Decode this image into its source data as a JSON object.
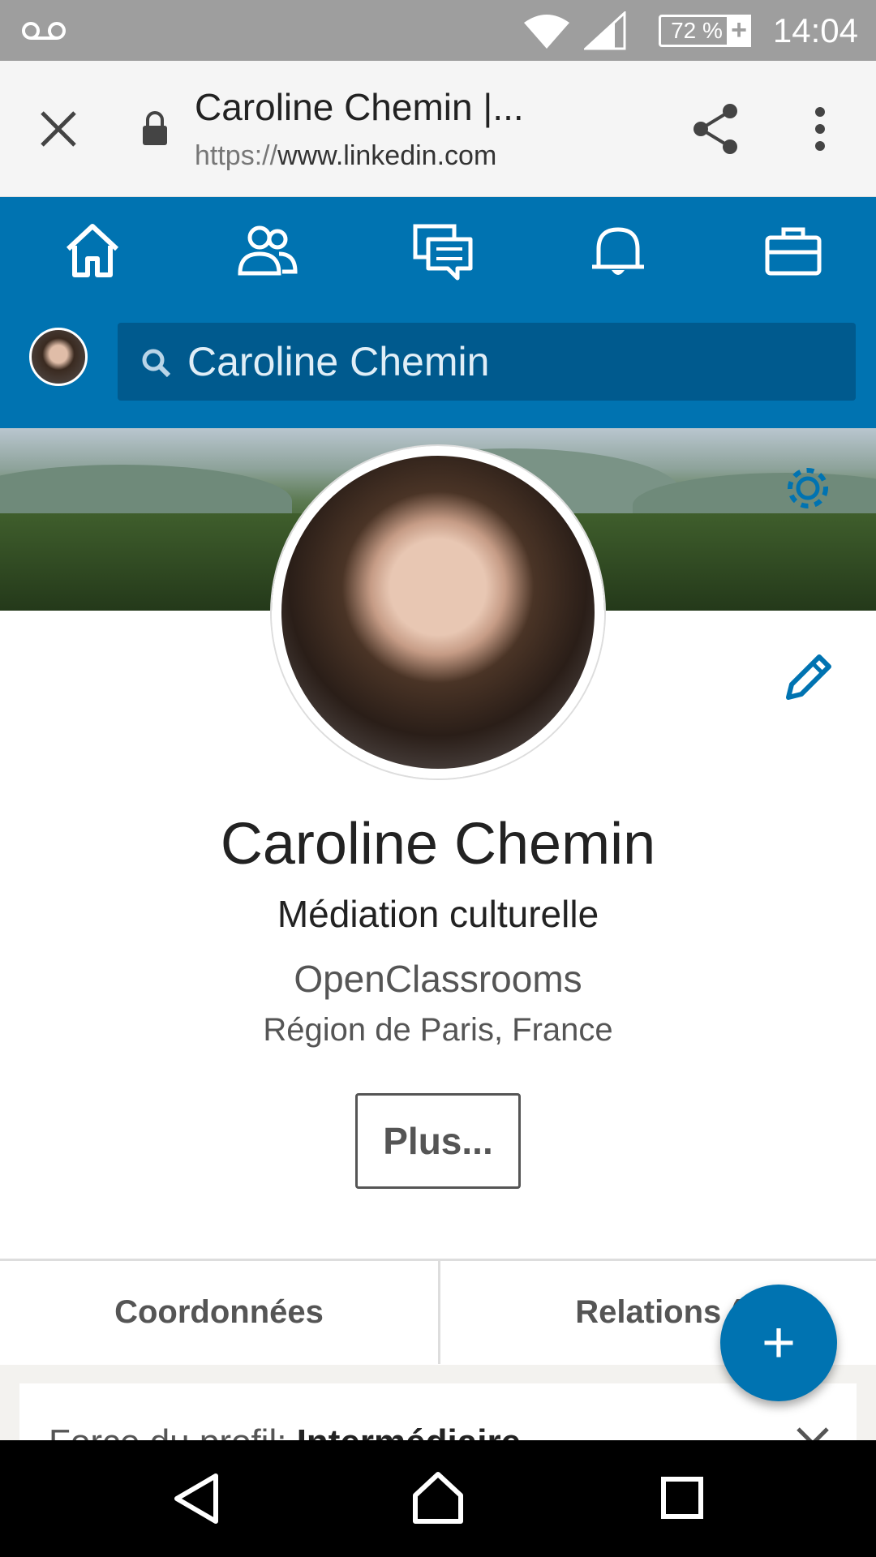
{
  "status_bar": {
    "battery": "72 %",
    "time": "14:04"
  },
  "browser": {
    "title": "Caroline Chemin |...",
    "url_scheme": "https://",
    "url_host": "www.linkedin.com"
  },
  "search": {
    "value": "Caroline Chemin"
  },
  "profile": {
    "name": "Caroline Chemin",
    "headline": "Médiation culturelle",
    "company": "OpenClassrooms",
    "location": "Région de Paris, France",
    "more_label": "Plus..."
  },
  "tabs": {
    "contact_label": "Coordonnées",
    "relations_label": "Relations ("
  },
  "strength": {
    "label": "Force du profil:",
    "value": "Intermédiaire"
  },
  "fab_label": "+",
  "colors": {
    "brand": "#0073b1",
    "brand_dark": "#005a8e"
  },
  "icons": [
    "voicemail-icon",
    "wifi-icon",
    "signal-icon",
    "battery-icon",
    "close-icon",
    "lock-icon",
    "share-icon",
    "overflow-menu-icon",
    "home-icon",
    "network-icon",
    "messages-icon",
    "notifications-icon",
    "jobs-icon",
    "search-icon",
    "settings-icon",
    "edit-icon",
    "chevron-down-icon",
    "back-icon",
    "home-nav-icon",
    "recents-icon"
  ]
}
